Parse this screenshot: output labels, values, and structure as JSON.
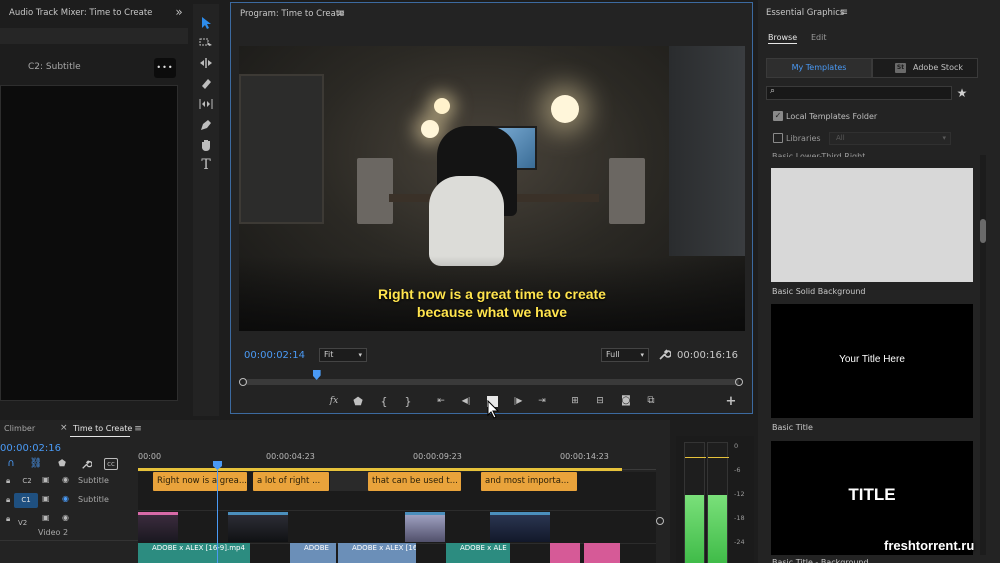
{
  "audio_mixer": {
    "title": "Audio Track Mixer: Time to Create",
    "expand_label": "»",
    "track_label": "C2: Subtitle",
    "more_label": "•••"
  },
  "program": {
    "title": "Program: Time to Create",
    "caption_line1": "Right now is a great time to create",
    "caption_line2": "because what we have",
    "timecode_current": "00:00:02:14",
    "timecode_total": "00:00:16:16",
    "zoom_value": "Fit",
    "quality_value": "Full",
    "fx_label": "fx",
    "playhead_percent": 14.5
  },
  "essential_graphics": {
    "title": "Essential Graphics",
    "tabs": [
      "Browse",
      "Edit"
    ],
    "sub_tabs": [
      "My Templates",
      "Adobe Stock"
    ],
    "stock_badge": "St",
    "local_templates_label": "Local Templates Folder",
    "libraries_label": "Libraries",
    "libraries_value": "All",
    "cut_label": "Basic Lower-Third Right",
    "templates": [
      {
        "name": "Basic Solid Background",
        "preview_text": ""
      },
      {
        "name": "Basic Title",
        "preview_text": "Your Title Here"
      },
      {
        "name": "Basic Title - Background",
        "preview_text": "TITLE"
      }
    ]
  },
  "timeline": {
    "tabs": [
      "Climber",
      "Time to Create"
    ],
    "close_label": "×",
    "timecode": "00:00:02:16",
    "ruler": [
      "00:00",
      "00:00:04:23",
      "00:00:09:23",
      "00:00:14:23"
    ],
    "tracks": [
      {
        "id": "C2",
        "name": "Subtitle"
      },
      {
        "id": "C1",
        "name": "Subtitle"
      },
      {
        "id": "V2",
        "name": "Video 2"
      }
    ],
    "captions": [
      "Right now is a grea...",
      "a lot of right ...",
      "that can be used t...",
      "and most importa..."
    ],
    "audio_clips": [
      "ADOBE x ALEX [16-9].mp4",
      "ADOBE",
      "ADOBE x ALEX [16",
      "ADOBE x ALE"
    ]
  },
  "meter": {
    "scale": [
      "0",
      "-6",
      "-12",
      "-18",
      "-24"
    ]
  },
  "watermark": "freshtorrent.ru"
}
